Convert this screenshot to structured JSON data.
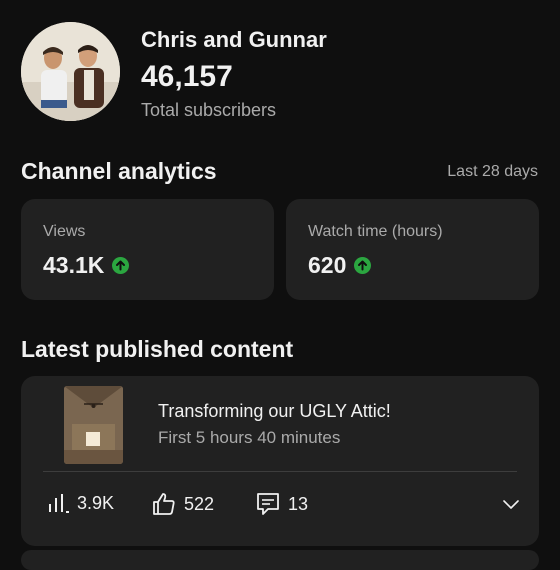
{
  "channel": {
    "name": "Chris and Gunnar",
    "subscriber_count": "46,157",
    "subscriber_label": "Total subscribers"
  },
  "analytics": {
    "title": "Channel analytics",
    "range": "Last 28 days",
    "stats": [
      {
        "label": "Views",
        "value": "43.1K",
        "trend_icon": "arrow-up-icon"
      },
      {
        "label": "Watch time (hours)",
        "value": "620",
        "trend_icon": "arrow-up-icon"
      }
    ]
  },
  "latest": {
    "title": "Latest published content",
    "video": {
      "title": "Transforming our UGLY Attic!",
      "subtitle": "First 5 hours 40 minutes",
      "views": "3.9K",
      "likes": "522",
      "comments": "13"
    }
  },
  "colors": {
    "background": "#0f0f0f",
    "card": "#212121",
    "trend_up": "#2ba640",
    "secondary_text": "#aaaaaa"
  }
}
